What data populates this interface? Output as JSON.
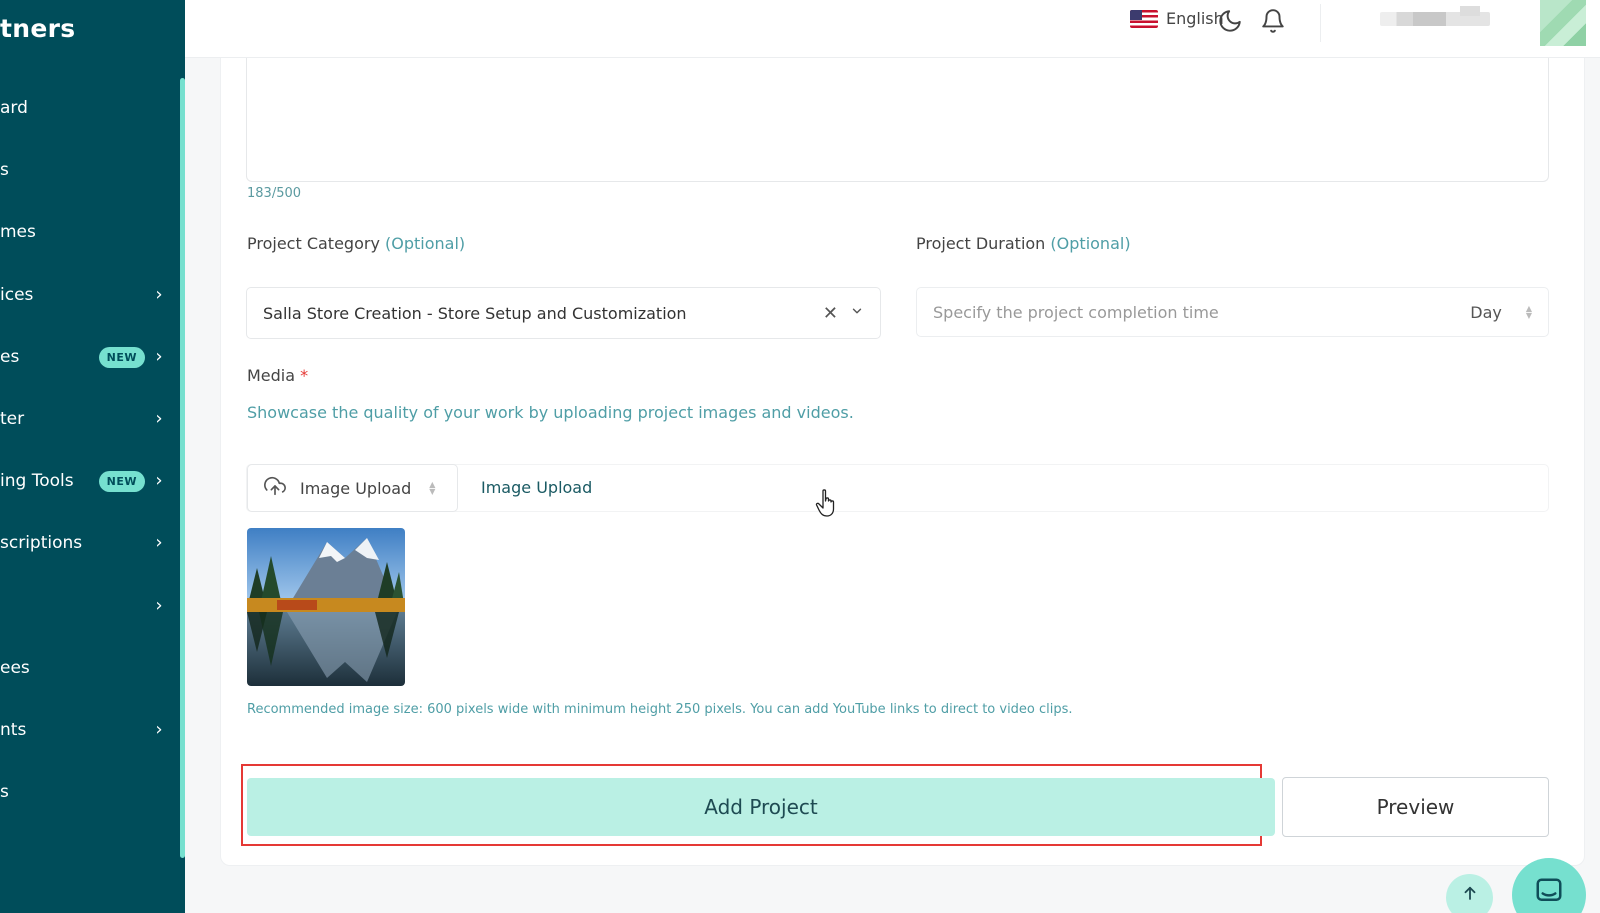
{
  "sidebar": {
    "brand": "tners",
    "items": [
      {
        "label": "ard",
        "chevron": false,
        "badge": ""
      },
      {
        "label": "s",
        "chevron": false,
        "badge": ""
      },
      {
        "label": "mes",
        "chevron": false,
        "badge": ""
      },
      {
        "label": "ices",
        "chevron": true,
        "badge": ""
      },
      {
        "label": "es",
        "chevron": true,
        "badge": "NEW"
      },
      {
        "label": "ter",
        "chevron": true,
        "badge": ""
      },
      {
        "label": "ing Tools",
        "chevron": true,
        "badge": "NEW"
      },
      {
        "label": "scriptions",
        "chevron": true,
        "badge": ""
      },
      {
        "label": "",
        "chevron": true,
        "badge": ""
      },
      {
        "label": "ees",
        "chevron": false,
        "badge": ""
      },
      {
        "label": "nts",
        "chevron": true,
        "badge": ""
      },
      {
        "label": "s",
        "chevron": false,
        "badge": ""
      }
    ]
  },
  "topbar": {
    "language": "English",
    "icons": [
      "us-flag-icon",
      "moon-icon",
      "bell-icon"
    ]
  },
  "form": {
    "description_char_count": "183/500",
    "category": {
      "label": "Project Category",
      "optional": "(Optional)",
      "value": "Salla Store Creation - Store Setup and Customization"
    },
    "duration": {
      "label": "Project Duration",
      "optional": "(Optional)",
      "placeholder": "Specify the project completion time",
      "unit": "Day"
    },
    "media": {
      "label": "Media",
      "required_mark": "*",
      "description": "Showcase the quality of your work by uploading project images and videos.",
      "upload_type": "Image Upload",
      "upload_link": "Image Upload",
      "hint": "Recommended image size: 600 pixels wide with minimum height 250 pixels. You can add YouTube links to direct to video clips."
    },
    "actions": {
      "add_project": "Add Project",
      "preview": "Preview"
    }
  },
  "colors": {
    "sidebar_bg": "#004d5a",
    "accent": "#76e0cf",
    "primary_button_bg": "#baf0e4",
    "optional_text": "#4f9ea6",
    "highlight_border": "#e53935"
  }
}
